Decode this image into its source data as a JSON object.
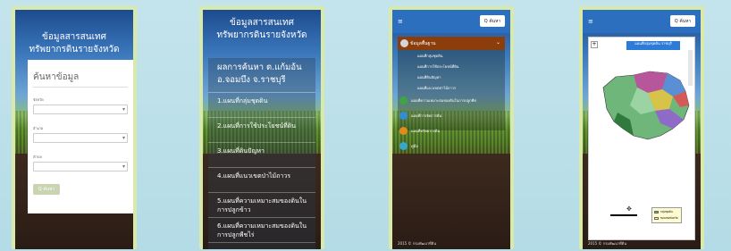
{
  "phone1": {
    "title_line1": "ข้อมูลสารสนเทศ",
    "title_line2": "ทรัพยากรดินรายจังหวัด",
    "card_title": "ค้นหาข้อมูล",
    "province_label": "จังหวัด",
    "district_label": "อำเภอ",
    "subdistrict_label": "ตำบล",
    "search_label": "Q ค้นหา"
  },
  "phone2": {
    "title_line1": "ข้อมูลสารสนเทศ",
    "title_line2": "ทรัพยากรดินรายจังหวัด",
    "result_line1": "ผลการค้นหา ต.แก้มอ้น",
    "result_line2": "อ.จอมบึง จ.ราชบุรี",
    "items": [
      "1.แผนที่กลุ่มชุดดิน",
      "2.แผนที่การใช้ประโยชน์ที่ดิน",
      "3.แผนที่ดินปัญหา",
      "4.แผนที่แนวเขตป่าไม้ถาวร",
      "5.แผนที่ความเหมาะสมของดินในการปลูกข้าว",
      "6.แผนที่ความเหมาะสมของดินในการปลูกพืชไร่"
    ]
  },
  "phone3": {
    "menu_icon": "≡",
    "search_label": "Q ค้นหา",
    "menu_header": "ข้อมูลพื้นฐาน",
    "sub_items": [
      "แผนที่กลุ่มชุดดิน",
      "แผนที่การใช้ประโยชน์ที่ดิน",
      "แผนที่ดินปัญหา",
      "แผนที่แนวเขตป่าไม้ถาวร"
    ],
    "items": [
      {
        "label": "แผนที่ความเหมาะสมของดินในการปลูกพืช",
        "color": "#3ea543"
      },
      {
        "label": "แผนที่การจัดการดิน",
        "color": "#2f8fd6"
      },
      {
        "label": "แผนที่ทรัพยากรดิน",
        "color": "#e28a1b"
      },
      {
        "label": "คู่มือ",
        "color": "#37a7c9"
      }
    ],
    "footer": "2015 © กรมพัฒนาที่ดิน"
  },
  "phone4": {
    "menu_icon": "≡",
    "search_label": "Q ค้นหา",
    "map_title": "แผนที่กลุ่มชุดดิน ราชบุรี",
    "legend_items": [
      "กลุ่มชุดดิน",
      "ขอบเขตจังหวัด"
    ],
    "footer": "2015 © กรมพัฒนาที่ดิน"
  },
  "colors": {
    "topbar": "#2c6fbf",
    "menu_header": "#8c3d0c",
    "phone_frame": "#d9e9a9"
  }
}
